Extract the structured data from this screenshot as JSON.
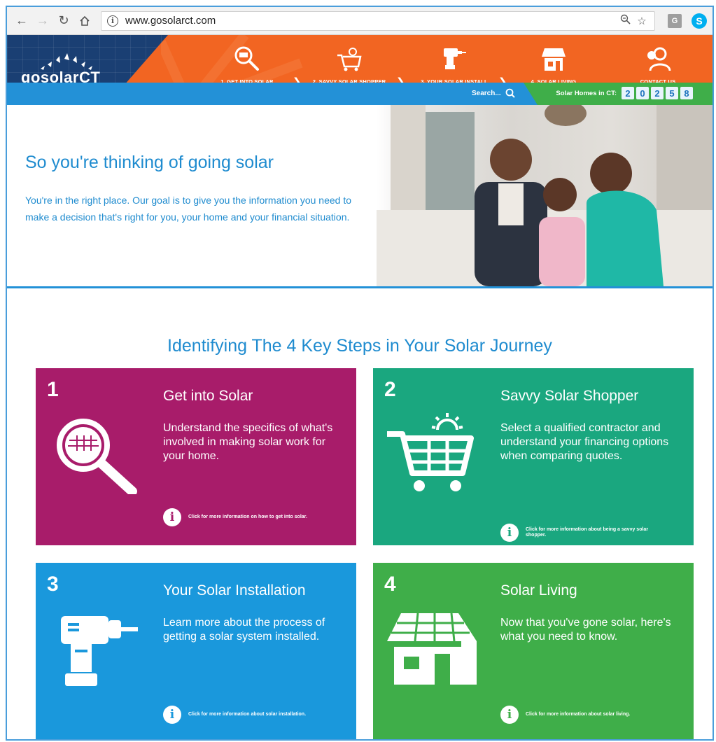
{
  "browser": {
    "url": "www.gosolarct.com",
    "info_glyph": "i",
    "ext_g_label": "G",
    "ext_s_label": "S"
  },
  "header": {
    "logo_text": "gosolarCT",
    "nav": [
      {
        "label": "1. GET INTO SOLAR",
        "icon": "magnifier-panel-icon"
      },
      {
        "label": "2. SAVVY SOLAR SHOPPER",
        "icon": "cart-sun-icon"
      },
      {
        "label": "3. YOUR SOLAR INSTALL",
        "icon": "drill-icon"
      },
      {
        "label": "4. SOLAR LIVING",
        "icon": "house-panel-icon"
      },
      {
        "label": "CONTACT US",
        "icon": "contact-person-icon"
      }
    ],
    "search_label": "Search...",
    "counter_label": "Solar Homes in CT:",
    "counter_digits": [
      "2",
      "0",
      "2",
      "5",
      "8"
    ]
  },
  "hero": {
    "title": "So you're thinking of going solar",
    "text": "You're in the right place. Our goal is to give you the information you need to make a decision that's right for you, your home and your financial situation."
  },
  "steps": {
    "title": "Identifying The 4 Key Steps in Your Solar Journey",
    "cards": [
      {
        "number": "1",
        "title": "Get into Solar",
        "desc": "Understand the specifics of what's involved in making solar work for your home.",
        "more": "Click for more information on how to get into solar.",
        "color": "#a81c6a"
      },
      {
        "number": "2",
        "title": "Savvy Solar Shopper",
        "desc": "Select a qualified contractor and understand your financing options when comparing quotes.",
        "more": "Click for more information about being a savvy solar shopper.",
        "color": "#1aa77f"
      },
      {
        "number": "3",
        "title": "Your Solar Installation",
        "desc": "Learn more about the process of getting a solar system installed.",
        "more": "Click for more information about solar installation.",
        "color": "#1a98dc"
      },
      {
        "number": "4",
        "title": "Solar Living",
        "desc": "Now that you've gone solar, here's what you need to know.",
        "more": "Click for more information about solar living.",
        "color": "#3fae49"
      }
    ]
  },
  "colors": {
    "header_orange": "#f26522",
    "logo_navy": "#1a3f73",
    "bar_blue": "#2391d7",
    "bar_green": "#3fae49",
    "text_blue": "#1e8bcf"
  }
}
